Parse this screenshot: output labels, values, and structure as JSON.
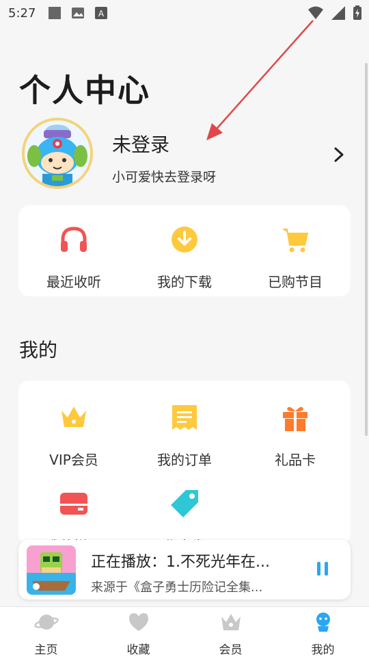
{
  "status_bar": {
    "time": "5:27"
  },
  "page": {
    "title": "个人中心"
  },
  "profile": {
    "name": "未登录",
    "subtitle": "小可爱快去登录呀"
  },
  "quick_actions": [
    {
      "label": "最近收听",
      "icon": "headphones-icon"
    },
    {
      "label": "我的下载",
      "icon": "download-icon"
    },
    {
      "label": "已购节目",
      "icon": "cart-icon"
    }
  ],
  "mine": {
    "title": "我的",
    "items": [
      {
        "label": "VIP会员",
        "icon": "crown-icon"
      },
      {
        "label": "我的订单",
        "icon": "order-icon"
      },
      {
        "label": "礼品卡",
        "icon": "gift-icon"
      },
      {
        "label": "我的拼团",
        "icon": "group-buy-icon"
      },
      {
        "label": "优惠券",
        "icon": "coupon-icon"
      }
    ]
  },
  "player": {
    "now_playing": "正在播放：1.不死光年在...",
    "source": "来源于《盒子勇士历险记全集..."
  },
  "tabs": [
    {
      "label": "主页",
      "icon": "planet-icon",
      "active": false
    },
    {
      "label": "收藏",
      "icon": "heart-icon",
      "active": false
    },
    {
      "label": "会员",
      "icon": "crown-icon",
      "active": false
    },
    {
      "label": "我的",
      "icon": "mascot-icon",
      "active": true
    }
  ],
  "colors": {
    "accent_blue": "#2aa7f0",
    "crown_yellow": "#ffc93d",
    "gift_orange": "#ff7a2a",
    "coupon_cyan": "#2fc7d6",
    "red": "#f05454"
  }
}
